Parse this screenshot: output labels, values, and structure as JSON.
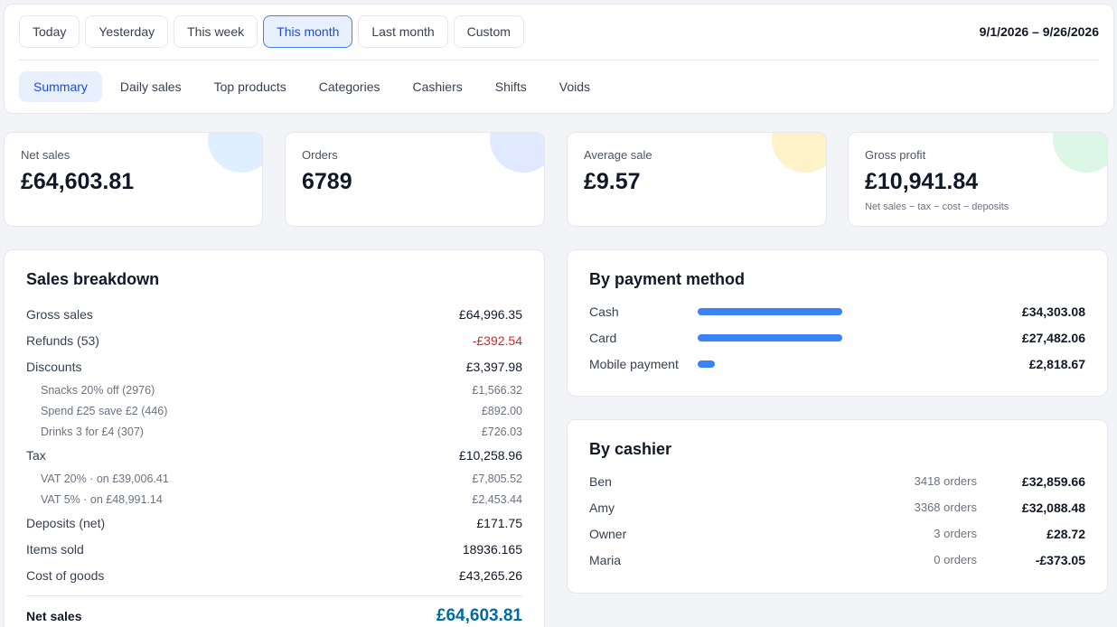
{
  "range_buttons": [
    {
      "label": "Today",
      "active": false
    },
    {
      "label": "Yesterday",
      "active": false
    },
    {
      "label": "This week",
      "active": false
    },
    {
      "label": "This month",
      "active": true
    },
    {
      "label": "Last month",
      "active": false
    },
    {
      "label": "Custom",
      "active": false
    }
  ],
  "date_range": "9/1/2026 – 9/26/2026",
  "tabs": [
    {
      "label": "Summary",
      "active": true
    },
    {
      "label": "Daily sales",
      "active": false
    },
    {
      "label": "Top products",
      "active": false
    },
    {
      "label": "Categories",
      "active": false
    },
    {
      "label": "Cashiers",
      "active": false
    },
    {
      "label": "Shifts",
      "active": false
    },
    {
      "label": "Voids",
      "active": false
    }
  ],
  "stats": [
    {
      "label": "Net sales",
      "value": "£64,603.81",
      "note": "",
      "color": "#e0efff"
    },
    {
      "label": "Orders",
      "value": "6789",
      "note": "",
      "color": "#e0e9ff"
    },
    {
      "label": "Average sale",
      "value": "£9.57",
      "note": "",
      "color": "#fdf2c8"
    },
    {
      "label": "Gross profit",
      "value": "£10,941.84",
      "note": "Net sales − tax − cost − deposits",
      "color": "#dcf7e6"
    }
  ],
  "breakdown": {
    "title": "Sales breakdown",
    "rows": [
      {
        "label": "Gross sales",
        "value": "£64,996.35",
        "sub": [],
        "negative": false
      },
      {
        "label": "Refunds (53)",
        "value": "-£392.54",
        "sub": [],
        "negative": true
      },
      {
        "label": "Discounts",
        "value": "£3,397.98",
        "negative": false,
        "sub": [
          {
            "label": "Snacks 20% off (2976)",
            "value": "£1,566.32"
          },
          {
            "label": "Spend £25 save £2 (446)",
            "value": "£892.00"
          },
          {
            "label": "Drinks 3 for £4 (307)",
            "value": "£726.03"
          }
        ]
      },
      {
        "label": "Tax",
        "value": "£10,258.96",
        "negative": false,
        "sub": [
          {
            "label": "VAT 20% · on £39,006.41",
            "value": "£7,805.52"
          },
          {
            "label": "VAT 5% · on £48,991.14",
            "value": "£2,453.44"
          }
        ]
      },
      {
        "label": "Deposits (net)",
        "value": "£171.75",
        "sub": [],
        "negative": false
      },
      {
        "label": "Items sold",
        "value": "18936.165",
        "sub": [],
        "negative": false
      },
      {
        "label": "Cost of goods",
        "value": "£43,265.26",
        "sub": [],
        "negative": false
      }
    ],
    "net_label": "Net sales",
    "net_value": "£64,603.81"
  },
  "payments": {
    "title": "By payment method",
    "rows": [
      {
        "name": "Cash",
        "amount": "£34,303.08",
        "share": 1.0
      },
      {
        "name": "Card",
        "amount": "£27,482.06",
        "share": 1.0
      },
      {
        "name": "Mobile payment",
        "amount": "£2,818.67",
        "share": 0.12
      }
    ]
  },
  "cashiers": {
    "title": "By cashier",
    "rows": [
      {
        "name": "Ben",
        "orders": "3418 orders",
        "amount": "£32,859.66"
      },
      {
        "name": "Amy",
        "orders": "3368 orders",
        "amount": "£32,088.48"
      },
      {
        "name": "Owner",
        "orders": "3 orders",
        "amount": "£28.72"
      },
      {
        "name": "Maria",
        "orders": "0 orders",
        "amount": "-£373.05"
      }
    ]
  }
}
